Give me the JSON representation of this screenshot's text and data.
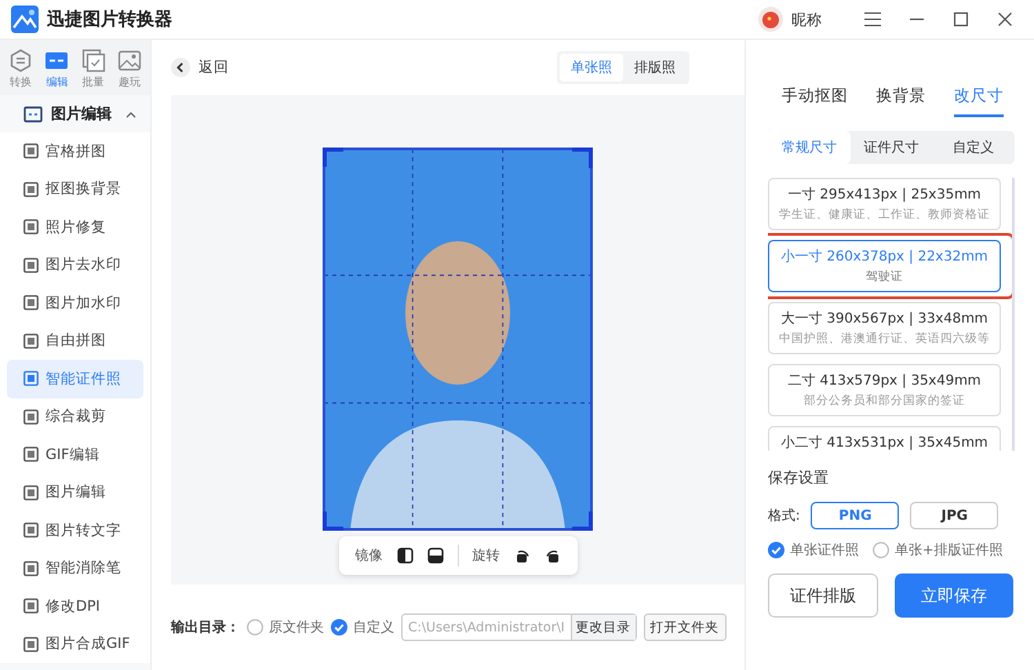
{
  "app": {
    "title": "迅捷图片转换器",
    "user": "昵称"
  },
  "mode_tabs": [
    {
      "label": "转换",
      "selected": false
    },
    {
      "label": "编辑",
      "selected": true
    },
    {
      "label": "批量",
      "selected": false
    },
    {
      "label": "趣玩",
      "selected": false
    }
  ],
  "sidebar": {
    "group": {
      "label": "图片编辑",
      "expanded": true
    },
    "items": [
      {
        "label": "宫格拼图",
        "selected": false
      },
      {
        "label": "抠图换背景",
        "selected": false
      },
      {
        "label": "照片修复",
        "selected": false
      },
      {
        "label": "图片去水印",
        "selected": false
      },
      {
        "label": "图片加水印",
        "selected": false
      },
      {
        "label": "自由拼图",
        "selected": false
      },
      {
        "label": "智能证件照",
        "selected": true
      },
      {
        "label": "综合裁剪",
        "selected": false
      },
      {
        "label": "GIF编辑",
        "selected": false
      },
      {
        "label": "图片编辑",
        "selected": false
      },
      {
        "label": "图片转文字",
        "selected": false
      },
      {
        "label": "智能消除笔",
        "selected": false
      },
      {
        "label": "修改DPI",
        "selected": false
      },
      {
        "label": "图片合成GIF",
        "selected": false
      }
    ]
  },
  "back": "返回",
  "view_toggle": [
    {
      "label": "单张照",
      "selected": true
    },
    {
      "label": "排版照",
      "selected": false
    }
  ],
  "toolbar": {
    "mirror": "镜像",
    "rotate": "旋转"
  },
  "output": {
    "label": "输出目录：",
    "options": [
      {
        "label": "原文件夹",
        "selected": false
      },
      {
        "label": "自定义",
        "selected": true
      }
    ],
    "path": "C:\\Users\\Administrator\\I",
    "change": "更改目录",
    "open": "打开文件夹"
  },
  "edit_tabs": [
    {
      "label": "手动抠图",
      "selected": false
    },
    {
      "label": "换背景",
      "selected": false
    },
    {
      "label": "改尺寸",
      "selected": true
    }
  ],
  "size_tabs": [
    {
      "label": "常规尺寸",
      "selected": true
    },
    {
      "label": "证件尺寸",
      "selected": false
    },
    {
      "label": "自定义",
      "selected": false
    }
  ],
  "sizes": [
    {
      "title": "一寸 295x413px | 25x35mm",
      "use": "学生证、健康证、工作证、教师资格证",
      "selected": false
    },
    {
      "title": "小一寸 260x378px | 22x32mm",
      "use": "驾驶证",
      "selected": true
    },
    {
      "title": "大一寸 390x567px | 33x48mm",
      "use": "中国护照、港澳通行证、英语四六级等",
      "selected": false
    },
    {
      "title": "二寸 413x579px | 35x49mm",
      "use": "部分公务员和部分国家的签证",
      "selected": false
    },
    {
      "title": "小二寸 413x531px | 35x45mm",
      "selected": false
    }
  ],
  "save": {
    "title": "保存设置",
    "format_label": "格式:",
    "formats": [
      {
        "label": "PNG",
        "selected": true
      },
      {
        "label": "JPG",
        "selected": false
      }
    ],
    "layouts": [
      {
        "label": "单张证件照",
        "selected": true
      },
      {
        "label": "单张+排版证件照",
        "selected": false
      }
    ]
  },
  "buttons": {
    "layout": "证件排版",
    "save": "立即保存"
  }
}
